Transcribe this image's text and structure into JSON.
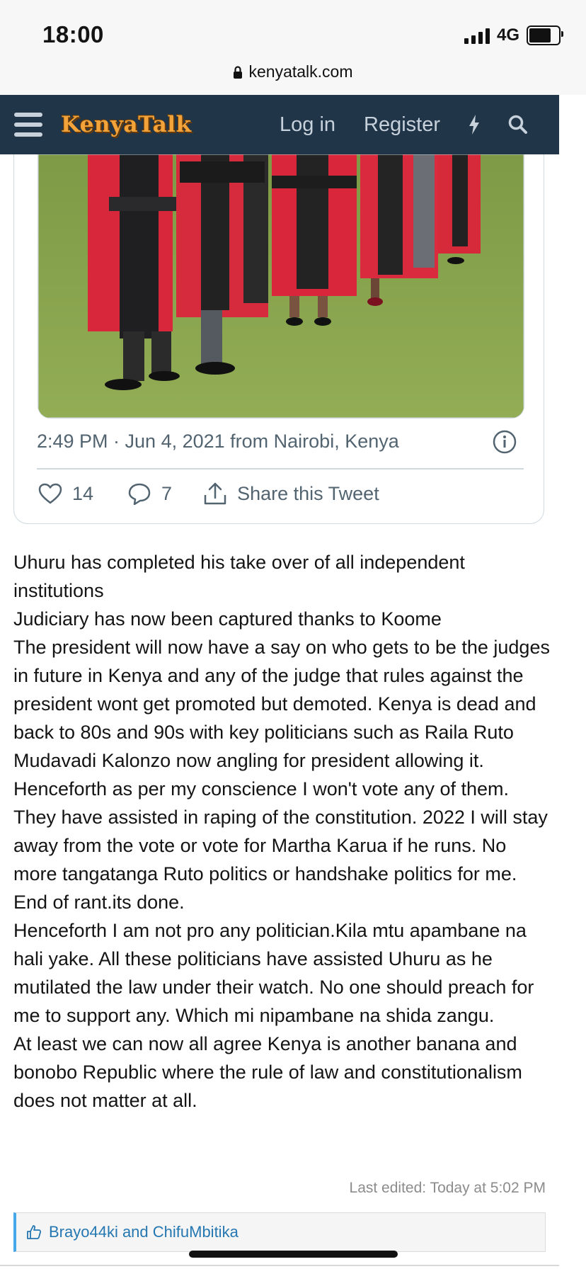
{
  "status_bar": {
    "time": "18:00",
    "network": "4G"
  },
  "browser": {
    "url": "kenyatalk.com"
  },
  "site_header": {
    "logo": "KenyaTalk",
    "login_label": "Log in",
    "register_label": "Register"
  },
  "tweet": {
    "meta": "2:49 PM · Jun 4, 2021 from Nairobi, Kenya",
    "likes": "14",
    "replies": "7",
    "share_label": "Share this Tweet"
  },
  "post": {
    "paragraphs": [
      "Uhuru has completed his take over of all independent institutions",
      "Judiciary has now been captured thanks to Koome",
      "The president will now have a say on who gets to be the judges in future in Kenya and any of the judge that rules against the president wont get promoted but demoted. Kenya is dead and back to 80s and 90s with key politicians such as Raila Ruto Mudavadi Kalonzo now angling for president allowing it. Henceforth as per my conscience I won't vote any of them. They have assisted in raping of the constitution. 2022 I will stay away from the vote or vote for Martha Karua if he runs. No more tangatanga Ruto politics or handshake politics for me. End of rant.its done.",
      "Henceforth I am not pro any politician.Kila mtu apambane na hali yake. All these politicians have assisted Uhuru as he mutilated the law under their watch. No one should preach for me to support any. Which mi nipambane na shida zangu.",
      "At least we can now all agree Kenya is another banana and bonobo Republic where the rule of law and constitutionalism does not matter at all."
    ],
    "last_edited": "Last edited: Today at 5:02 PM",
    "reactions": "Brayo44ki and ChifuMbitika"
  },
  "colors": {
    "header_bg": "#213548",
    "logo": "#f2a33a",
    "link": "#2577b1",
    "accent_bar": "#47a7eb"
  }
}
